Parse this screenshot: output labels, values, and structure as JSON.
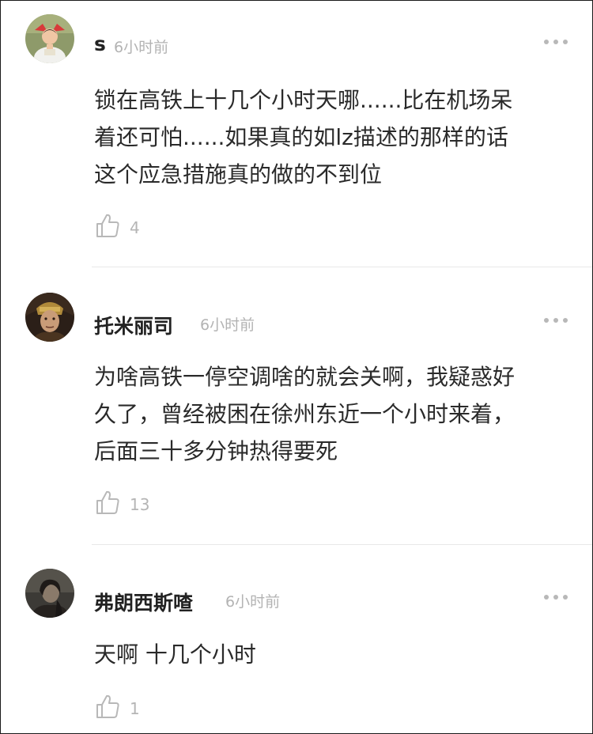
{
  "comments": [
    {
      "username": "s",
      "time": "6小时前",
      "content": "锁在高铁上十几个小时天哪......比在机场呆\n着还可怕......如果真的如lz描述的那样的话\n这个应急措施真的做的不到位",
      "likes": "4",
      "avatar_icon": "avatar-child-photo"
    },
    {
      "username": "托米丽司",
      "time": "6小时前",
      "content": "为啥高铁一停空调啥的就会关啊，我疑惑好\n久了，曾经被困在徐州东近一个小时来着，\n后面三十多分钟热得要死",
      "likes": "13",
      "avatar_icon": "avatar-character-portrait"
    },
    {
      "username": "弗朗西斯喳",
      "time": "6小时前",
      "content": "天啊 十几个小时",
      "likes": "1",
      "avatar_icon": "avatar-dark-photo"
    }
  ],
  "icons": {
    "more": "more-dots-icon",
    "like": "thumbs-up-icon"
  },
  "colors": {
    "username": "#222222",
    "time": "#b3b3b3",
    "content": "#2a2a2a",
    "like_count": "#b5b5b5",
    "divider": "#e8e8e8"
  }
}
